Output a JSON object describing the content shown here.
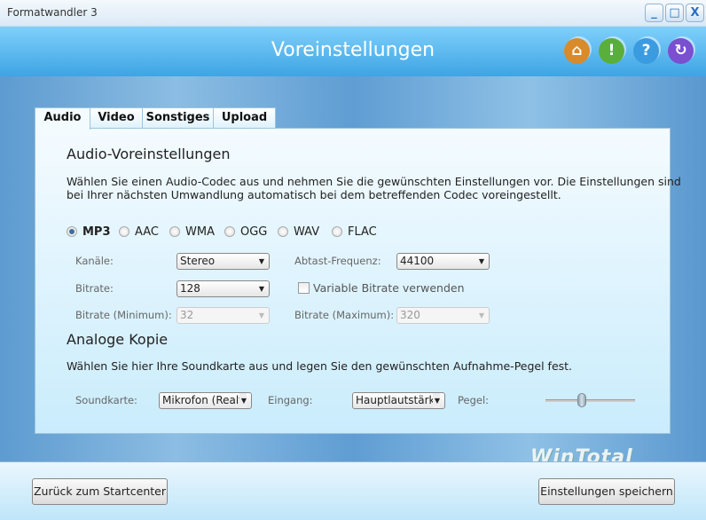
{
  "window": {
    "title": "Formatwandler 3",
    "controls": [
      "_",
      "□",
      "X"
    ]
  },
  "header": {
    "title": "Voreinstellungen",
    "icons": [
      "home-icon",
      "info-icon",
      "help-icon",
      "update-icon"
    ]
  },
  "tabs": [
    "Audio",
    "Video",
    "Sonstiges",
    "Upload"
  ],
  "audio": {
    "heading": "Audio-Voreinstellungen",
    "desc1": "Wählen Sie einen Audio-Codec aus und nehmen Sie die gewünschten Einstellungen vor. Die Einstellungen sind",
    "desc2": "bei Ihrer nächsten Umwandlung automatisch bei dem betreffenden Codec voreingestellt.",
    "codecs": [
      "MP3",
      "AAC",
      "WMA",
      "OGG",
      "WAV",
      "FLAC"
    ],
    "selected_codec": "MP3",
    "kanaele_label": "Kanäle:",
    "kanaele_value": "Stereo",
    "freq_label": "Abtast-Frequenz:",
    "freq_value": "44100",
    "bitrate_label": "Bitrate:",
    "bitrate_value": "128",
    "vbr_label": "Variable Bitrate verwenden",
    "vbr_checked": false,
    "bmin_label": "Bitrate (Minimum):",
    "bmin_value": "32",
    "bmax_label": "Bitrate (Maximum):",
    "bmax_value": "320"
  },
  "analog": {
    "heading": "Analoge Kopie",
    "desc": "Wählen Sie hier Ihre Soundkarte aus und legen Sie den gewünschten Aufnahme-Pegel fest.",
    "sound_label": "Soundkarte:",
    "sound_value": "Mikrofon (Realt",
    "input_label": "Eingang:",
    "input_value": "Hauptlautstärk",
    "level_label": "Pegel:",
    "level_fraction": 0.4
  },
  "watermark": "WinTotal",
  "footer": {
    "back": "Zurück zum Startcenter",
    "save": "Einstellungen speichern"
  },
  "colors": {
    "header": "#3ea4e4",
    "home": "#d98a2a",
    "info": "#5aae3a",
    "help": "#3a9be0",
    "update": "#7a4fd0"
  }
}
